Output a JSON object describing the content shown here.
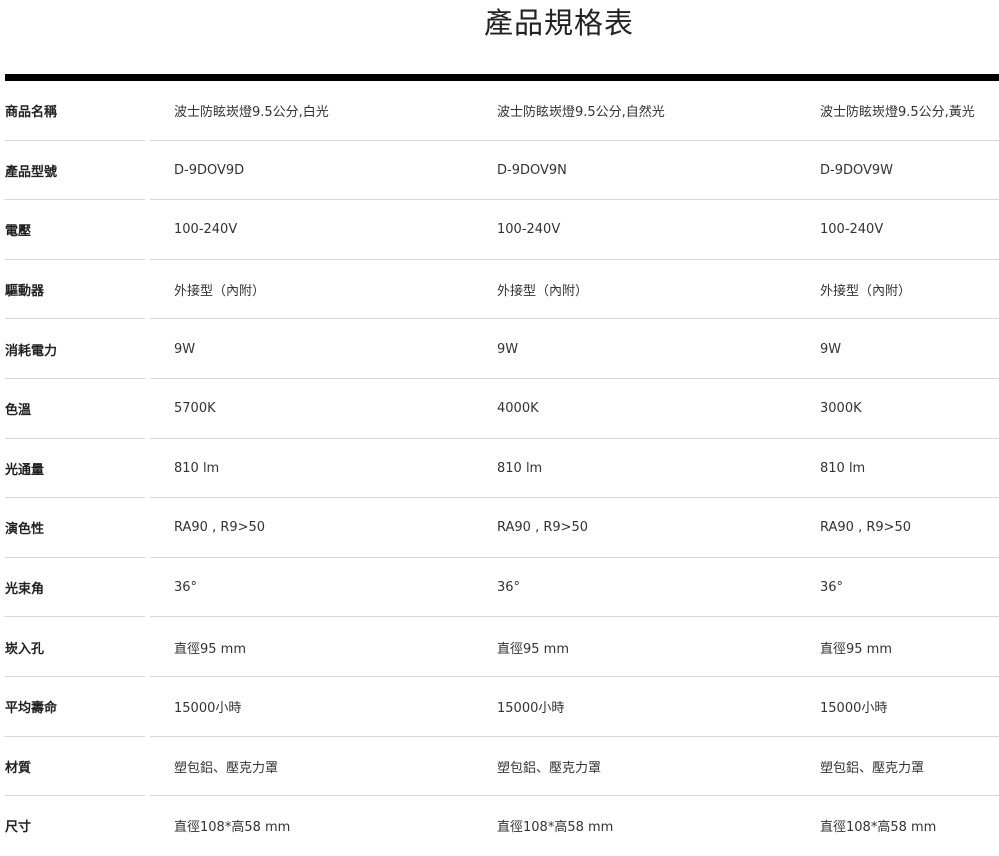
{
  "page": {
    "title": "產品規格表"
  },
  "spec_table": {
    "rows": [
      {
        "label": "商品名稱",
        "values": [
          "波士防眩崁燈9.5公分,白光",
          "波士防眩崁燈9.5公分,自然光",
          "波士防眩崁燈9.5公分,黃光"
        ]
      },
      {
        "label": "產品型號",
        "values": [
          "D-9DOV9D",
          "D-9DOV9N",
          "D-9DOV9W"
        ]
      },
      {
        "label": "電壓",
        "values": [
          "100-240V",
          "100-240V",
          "100-240V"
        ]
      },
      {
        "label": "驅動器",
        "values": [
          "外接型（內附）",
          "外接型（內附）",
          "外接型（內附）"
        ]
      },
      {
        "label": "消耗電力",
        "values": [
          "9W",
          "9W",
          "9W"
        ]
      },
      {
        "label": "色溫",
        "values": [
          "5700K",
          "4000K",
          "3000K"
        ]
      },
      {
        "label": "光通量",
        "values": [
          "810 lm",
          "810 lm",
          "810 lm"
        ]
      },
      {
        "label": "演色性",
        "values": [
          "RA90 , R9>50",
          "RA90 , R9>50",
          "RA90 , R9>50"
        ]
      },
      {
        "label": "光束角",
        "values": [
          "36°",
          "36°",
          "36°"
        ]
      },
      {
        "label": "崁入孔",
        "values": [
          "直徑95 mm",
          "直徑95 mm",
          "直徑95 mm"
        ]
      },
      {
        "label": "平均壽命",
        "values": [
          "15000小時",
          "15000小時",
          "15000小時"
        ]
      },
      {
        "label": "材質",
        "values": [
          "塑包鋁、壓克力罩",
          "塑包鋁、壓克力罩",
          "塑包鋁、壓克力罩"
        ]
      },
      {
        "label": "尺寸",
        "values": [
          "直徑108*高58 mm",
          "直徑108*高58 mm",
          "直徑108*高58 mm"
        ]
      }
    ]
  }
}
